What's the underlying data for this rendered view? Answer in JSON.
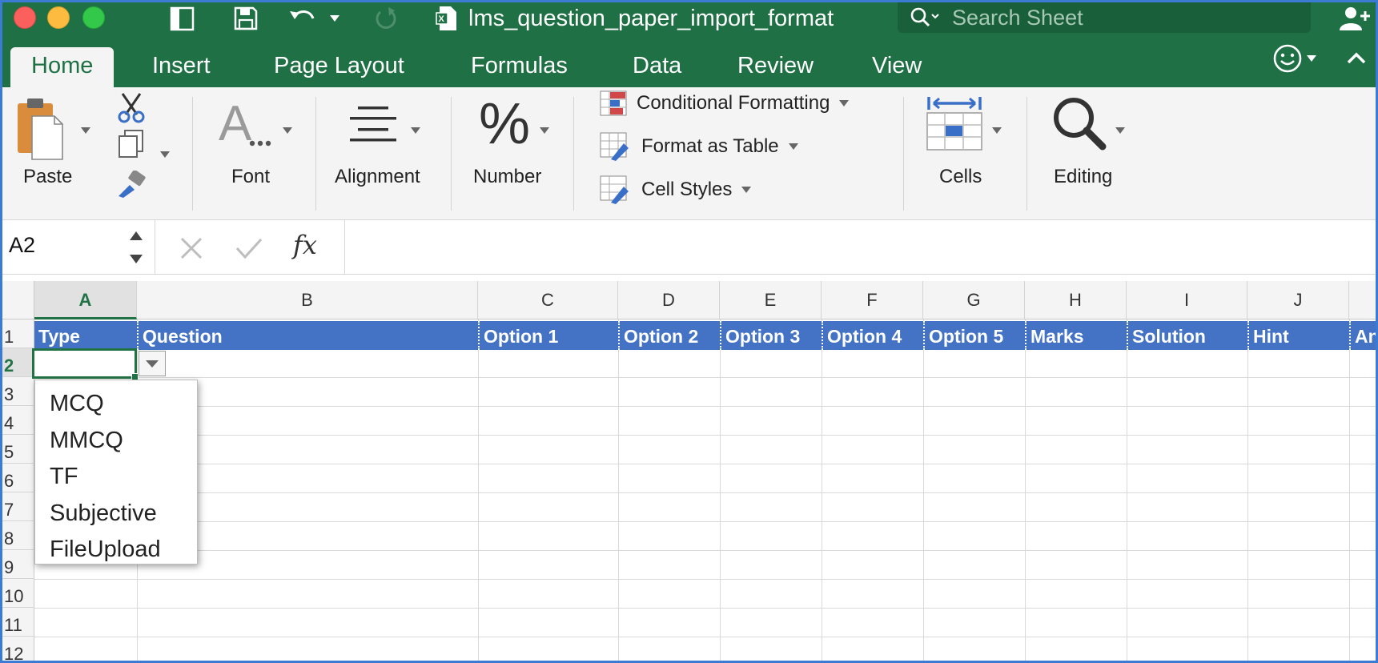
{
  "app": {
    "document_title": "lms_question_paper_import_format",
    "search_placeholder": "Search Sheet"
  },
  "ribbon_tabs": [
    "Home",
    "Insert",
    "Page Layout",
    "Formulas",
    "Data",
    "Review",
    "View"
  ],
  "ribbon": {
    "paste_label": "Paste",
    "font_label": "Font",
    "alignment_label": "Alignment",
    "number_label": "Number",
    "conditional_formatting_label": "Conditional Formatting",
    "format_as_table_label": "Format as Table",
    "cell_styles_label": "Cell Styles",
    "cells_label": "Cells",
    "editing_label": "Editing"
  },
  "formula_bar": {
    "name_box": "A2",
    "fx_label": "fx",
    "formula": ""
  },
  "columns": [
    "A",
    "B",
    "C",
    "D",
    "E",
    "F",
    "G",
    "H",
    "I",
    "J"
  ],
  "selected_column": "A",
  "rows": [
    "1",
    "2",
    "3",
    "4",
    "5",
    "6",
    "7",
    "8",
    "9",
    "10",
    "11",
    "12"
  ],
  "selected_row": "2",
  "header_row": [
    "Type",
    "Question",
    "Option 1",
    "Option 2",
    "Option 3",
    "Option 4",
    "Option 5",
    "Marks",
    "Solution",
    "Hint",
    "Ans"
  ],
  "dropdown_options": [
    "MCQ",
    "MMCQ",
    "TF",
    "Subjective",
    "FileUpload"
  ],
  "colors": {
    "title_bar": "#1f7145",
    "ribbon": "#f4f4f4",
    "header_fill": "#4472c4",
    "selection": "#217346"
  }
}
